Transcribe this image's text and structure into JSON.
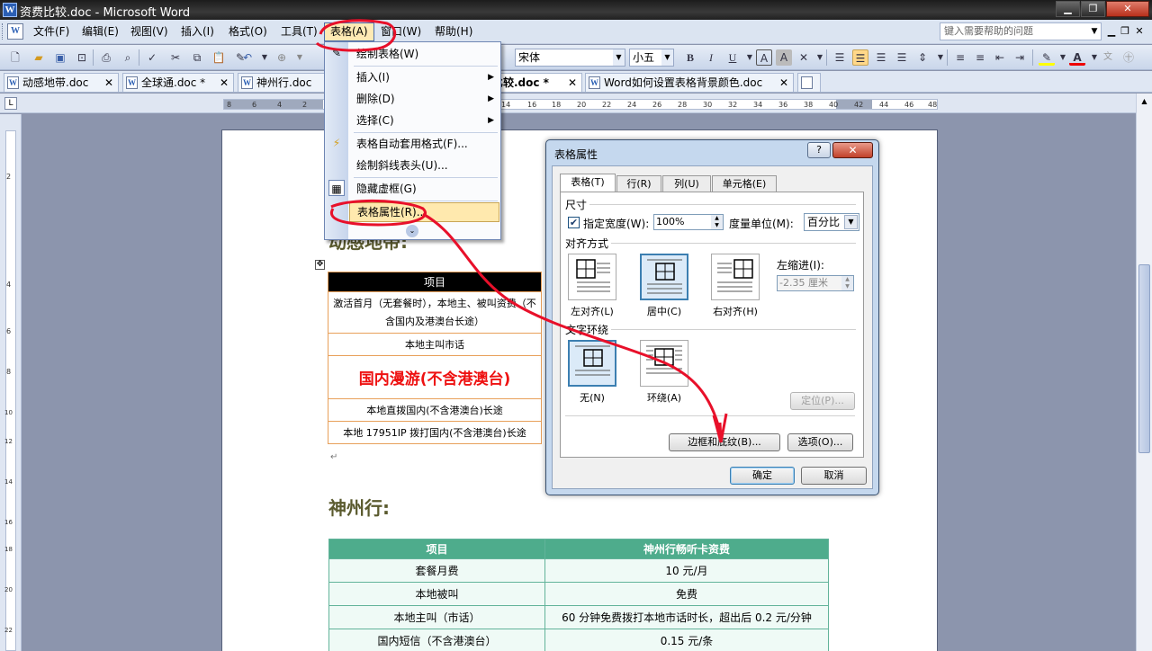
{
  "window": {
    "title": "资费比较.doc - Microsoft Word"
  },
  "menubar": {
    "items": [
      {
        "label": "文件(F)",
        "name": "menu-file"
      },
      {
        "label": "编辑(E)",
        "name": "menu-edit"
      },
      {
        "label": "视图(V)",
        "name": "menu-view"
      },
      {
        "label": "插入(I)",
        "name": "menu-insert"
      },
      {
        "label": "格式(O)",
        "name": "menu-format"
      },
      {
        "label": "工具(T)",
        "name": "menu-tools"
      },
      {
        "label": "表格(A)",
        "name": "menu-table"
      },
      {
        "label": "窗口(W)",
        "name": "menu-window"
      },
      {
        "label": "帮助(H)",
        "name": "menu-help"
      }
    ],
    "help_placeholder": "键入需要帮助的问题"
  },
  "toolbar": {
    "font_name": "宋体",
    "font_size": "小五",
    "bold": "B",
    "italic": "I",
    "underline": "U"
  },
  "tabs": [
    {
      "label": "动感地带.doc"
    },
    {
      "label": "全球通.doc *"
    },
    {
      "label": "神州行.doc"
    },
    {
      "label": "资费比较.doc *"
    },
    {
      "label": "Word如何设置表格背景颜色.doc"
    }
  ],
  "ruler_ticks": [
    "8",
    "6",
    "4",
    "2",
    "14",
    "16",
    "18",
    "20",
    "22",
    "24",
    "26",
    "28",
    "30",
    "32",
    "34",
    "36",
    "38",
    "40",
    "42",
    "44",
    "46",
    "48"
  ],
  "vruler_ticks": [
    "2",
    "4",
    "6",
    "8",
    "10",
    "12",
    "14",
    "16",
    "18",
    "20",
    "22"
  ],
  "table_menu": {
    "items": [
      {
        "label": "绘制表格(W)",
        "submenu": false
      },
      {
        "label": "插入(I)",
        "submenu": true
      },
      {
        "label": "删除(D)",
        "submenu": true
      },
      {
        "label": "选择(C)",
        "submenu": true
      },
      {
        "label": "表格自动套用格式(F)...",
        "submenu": false
      },
      {
        "label": "绘制斜线表头(U)...",
        "submenu": false
      },
      {
        "label": "隐藏虚框(G)",
        "submenu": false
      },
      {
        "label": "表格属性(R)...",
        "submenu": false
      }
    ],
    "expand_icon": "double-chevron-down"
  },
  "document": {
    "section1_heading": "动感地带:",
    "table1": {
      "header": "项目",
      "rows": [
        "激活首月（无套餐时），本地主、被叫资费（不含国内及港澳台长途）",
        "本地主叫市话",
        "国内漫游(不含港澳台)",
        "本地直拨国内(不含港澳台)长途",
        "本地 17951IP 拨打国内(不含港澳台)长途"
      ]
    },
    "section2_heading": "神州行:",
    "table2": {
      "headers": [
        "项目",
        "神州行畅听卡资费"
      ],
      "rows": [
        [
          "套餐月费",
          "10 元/月"
        ],
        [
          "本地被叫",
          "免费"
        ],
        [
          "本地主叫（市话）",
          "60 分钟免费拨打本地市话时长，超出后 0.2 元/分钟"
        ],
        [
          "国内短信（不含港澳台）",
          "0.15 元/条"
        ]
      ]
    }
  },
  "dialog": {
    "title": "表格属性",
    "help": "?",
    "close": "✕",
    "tabs": [
      "表格(T)",
      "行(R)",
      "列(U)",
      "单元格(E)"
    ],
    "size_group": "尺寸",
    "preferred_width_label": "指定宽度(W):",
    "preferred_width_checked": true,
    "preferred_width_value": "100%",
    "measure_label": "度量单位(M):",
    "measure_value": "百分比",
    "alignment_group": "对齐方式",
    "align_left": "左对齐(L)",
    "align_center": "居中(C)",
    "align_right": "右对齐(H)",
    "indent_label": "左缩进(I):",
    "indent_value": "-2.35 厘米",
    "wrap_group": "文字环绕",
    "wrap_none": "无(N)",
    "wrap_around": "环绕(A)",
    "position_button": "定位(P)...",
    "borders_button": "边框和底纹(B)...",
    "options_button": "选项(O)...",
    "ok_button": "确定",
    "cancel_button": "取消",
    "selected_alignment": "center",
    "selected_wrap": "none"
  },
  "colors": {
    "annotation_red": "#e8102a",
    "table2_header": "#4eac8c",
    "table1_border": "#e8a05a"
  }
}
